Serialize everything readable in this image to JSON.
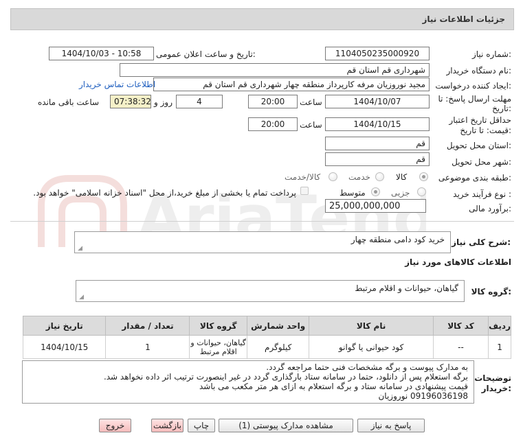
{
  "header": {
    "title": "جزئیات اطلاعات نیاز"
  },
  "form": {
    "need_number_label": "شماره نیاز:",
    "need_number": "1104050235000920",
    "announce_label": "تاریخ و ساعت اعلان عمومی:",
    "announce_value": "1404/10/03 - 10:58",
    "buyer_org_label": "نام دستگاه خریدار:",
    "buyer_org": "شهرداری قم استان قم",
    "requester_label": "ایجاد کننده درخواست:",
    "requester": "مجید نوروزیان مرفه کارپرداز منطقه چهار شهرداری قم استان قم",
    "contact_link": "اطلاعات تماس خریدار",
    "deadline_label_1": "مهلت ارسال پاسخ: تا",
    "deadline_label_2": "تاریخ:",
    "deadline_date": "1404/10/07",
    "time_label": "ساعت",
    "deadline_time": "20:00",
    "days_value": "4",
    "days_label": "روز و",
    "remaining_time": "07:38:32",
    "remaining_label": "ساعت باقی مانده",
    "validity_label_1": "حداقل تاریخ اعتبار",
    "validity_label_2": "قیمت: تا تاریخ:",
    "validity_date": "1404/10/15",
    "validity_time_label": "ساعت",
    "validity_time": "20:00",
    "province_label": "استان محل تحویل:",
    "province": "قم",
    "city_label": "شهر محل تحویل:",
    "city": "قم",
    "category_label": "طبقه بندی موضوعی:",
    "category_options": [
      "کالا",
      "خدمت",
      "کالا/خدمت"
    ],
    "process_label": "نوع فرآیند خرید :",
    "process_options": [
      "جزیی",
      "متوسط"
    ],
    "payment_note": "پرداخت تمام یا بخشی از مبلغ خرید،از محل \"اسناد خزانه اسلامی\" خواهد بود.",
    "estimate_label": "برآورد مالی:",
    "estimate_value": "25,000,000,000"
  },
  "summary": {
    "label": "شرح کلی نیاز:",
    "text": "خرید کود دامی منطقه چهار"
  },
  "goods_section": {
    "title": "اطلاعات کالاهای مورد نیاز",
    "group_label": "گروه کالا:",
    "group_value": "گیاهان، حیوانات و اقلام مرتبط"
  },
  "table": {
    "headers": [
      "ردیف",
      "کد کالا",
      "نام کالا",
      "واحد شمارش",
      "گروه کالا",
      "تعداد / مقدار",
      "تاریخ نیاز"
    ],
    "rows": [
      [
        "1",
        "--",
        "کود حیوانی یا گوانو",
        "کیلوگرم",
        "گیاهان، حیوانات و اقلام مرتبط",
        "1",
        "1404/10/15"
      ]
    ]
  },
  "notes": {
    "label_1": "توضیحات",
    "label_2": "خریدار:",
    "lines": [
      "به مدارک پیوست و برگه مشخصات فنی حتما مراجعه گردد.",
      "برگه استعلام پس از دانلود، حتما در سامانه ستاد بارگذاری گردد در غیر اینصورت ترتیب اثر داده نخواهد شد.",
      "قیمت پیشنهادی در سامانه ستاد و برگه استعلام به ازای هر متر مکعب می باشد",
      "09196036198   نوروزیان"
    ]
  },
  "buttons": {
    "reply": "پاسخ به نیاز",
    "attachments": "مشاهده مدارک پیوستی (1)",
    "print": "چاپ",
    "back": "بازگشت",
    "exit": "خروج"
  },
  "watermark": {
    "text": "AriaTender.net"
  }
}
